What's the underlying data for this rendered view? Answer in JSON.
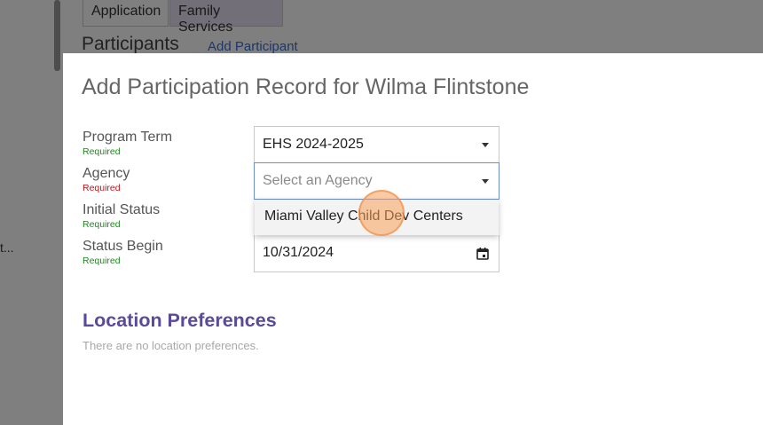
{
  "background": {
    "tabs": [
      {
        "label": "Application"
      },
      {
        "label": "Family Services"
      }
    ],
    "heading": "Participants",
    "add_link": "Add Participant",
    "truncated_text": "t..."
  },
  "modal": {
    "title": "Add Participation Record for Wilma Flintstone",
    "fields": {
      "program_term": {
        "label": "Program Term",
        "required": "Required",
        "value": "EHS 2024-2025"
      },
      "agency": {
        "label": "Agency",
        "required": "Required",
        "placeholder": "Select an Agency"
      },
      "initial_status": {
        "label": "Initial Status",
        "required": "Required"
      },
      "status_begin": {
        "label": "Status Begin",
        "required": "Required",
        "value": "10/31/2024"
      }
    },
    "agency_options": [
      "Miami Valley Child Dev Centers"
    ],
    "location_preferences": {
      "title": "Location Preferences",
      "empty_text": "There are no location preferences."
    }
  },
  "colors": {
    "overlay": "#000000",
    "section_title": "#5b4a9a",
    "required_ok": "#1e8a1e",
    "required_error": "#c0121c",
    "link": "#3b6fd6",
    "click_highlight": "#f7a05a"
  },
  "icons": {
    "dropdown": "caret-down-icon",
    "date": "calendar-icon"
  }
}
